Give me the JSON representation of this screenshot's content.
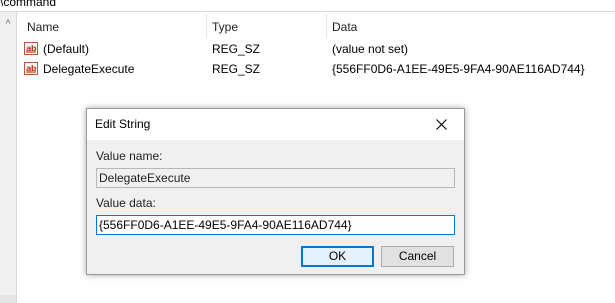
{
  "path": "\\command",
  "columns": {
    "name": "Name",
    "type": "Type",
    "data": "Data"
  },
  "rows": [
    {
      "icon": "ab",
      "name": "(Default)",
      "type": "REG_SZ",
      "data": "(value not set)"
    },
    {
      "icon": "ab",
      "name": "DelegateExecute",
      "type": "REG_SZ",
      "data": "{556FF0D6-A1EE-49E5-9FA4-90AE116AD744}"
    }
  ],
  "dialog": {
    "title": "Edit String",
    "value_name_label": "Value name:",
    "value_name": "DelegateExecute",
    "value_data_label": "Value data:",
    "value_data": "{556FF0D6-A1EE-49E5-9FA4-90AE116AD744}",
    "ok_label": "OK",
    "cancel_label": "Cancel"
  },
  "colors": {
    "accent": "#0078d7",
    "dialog_bg": "#f0f0f0",
    "icon_red": "#c0392b"
  },
  "icons": {
    "close": "close-icon",
    "reg_string": "string-value-icon",
    "scroll_up": "scroll-up-icon"
  }
}
